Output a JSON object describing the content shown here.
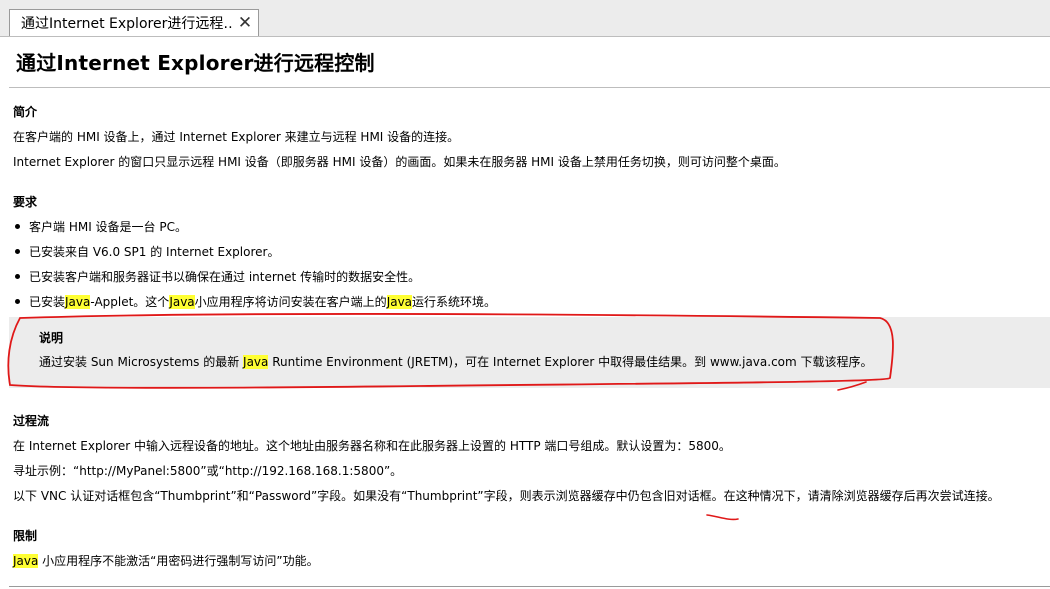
{
  "tab": {
    "label": "通过Internet Explorer进行远程…",
    "close_glyph": "✕"
  },
  "title": "通过Internet Explorer进行远程控制",
  "intro": {
    "heading": "简介",
    "lines": [
      "在客户端的 HMI 设备上，通过 Internet Explorer 来建立与远程 HMI 设备的连接。",
      "Internet Explorer 的窗口只显示远程 HMI 设备（即服务器 HMI 设备）的画面。如果未在服务器 HMI 设备上禁用任务切换，则可访问整个桌面。"
    ]
  },
  "requirements": {
    "heading": "要求",
    "items": [
      "客户端 HMI 设备是一台 PC。",
      "已安装来自 V6.0 SP1 的 Internet Explorer。",
      "已安装客户端和服务器证书以确保在通过 internet 传输时的数据安全性。"
    ],
    "java_item": {
      "part1": "已安装 ",
      "java1": "Java",
      "part2": "-Applet。这个 ",
      "java2": "Java",
      "part3": " 小应用程序将访问安装在客户端上的 ",
      "java3": "Java",
      "part4": " 运行系统环境。"
    }
  },
  "note": {
    "heading": "说明",
    "part1": "通过安装 Sun Microsystems 的最新 ",
    "java": "Java",
    "part2": " Runtime Environment (JRETM)，可在 Internet Explorer 中取得最佳结果。到 www.java.com 下载该程序。"
  },
  "process": {
    "heading": "过程流",
    "lines": [
      "在 Internet Explorer 中输入远程设备的地址。这个地址由服务器名称和在此服务器上设置的 HTTP 端口号组成。默认设置为：5800。",
      "寻址示例：“http://MyPanel:5800”或“http://192.168.168.1:5800”。",
      "以下 VNC 认证对话框包含“Thumbprint”和“Password”字段。如果没有“Thumbprint”字段，则表示浏览器缓存中仍包含旧对话框。在这种情况下，请清除浏览器缓存后再次尝试连接。"
    ]
  },
  "restrictions": {
    "heading": "限制",
    "java": "Java",
    "rest": " 小应用程序不能激活“用密码进行强制写访问”功能。"
  },
  "colors": {
    "highlight": "#ffff33",
    "annotation": "#e01818",
    "note_bg": "#ececec"
  }
}
